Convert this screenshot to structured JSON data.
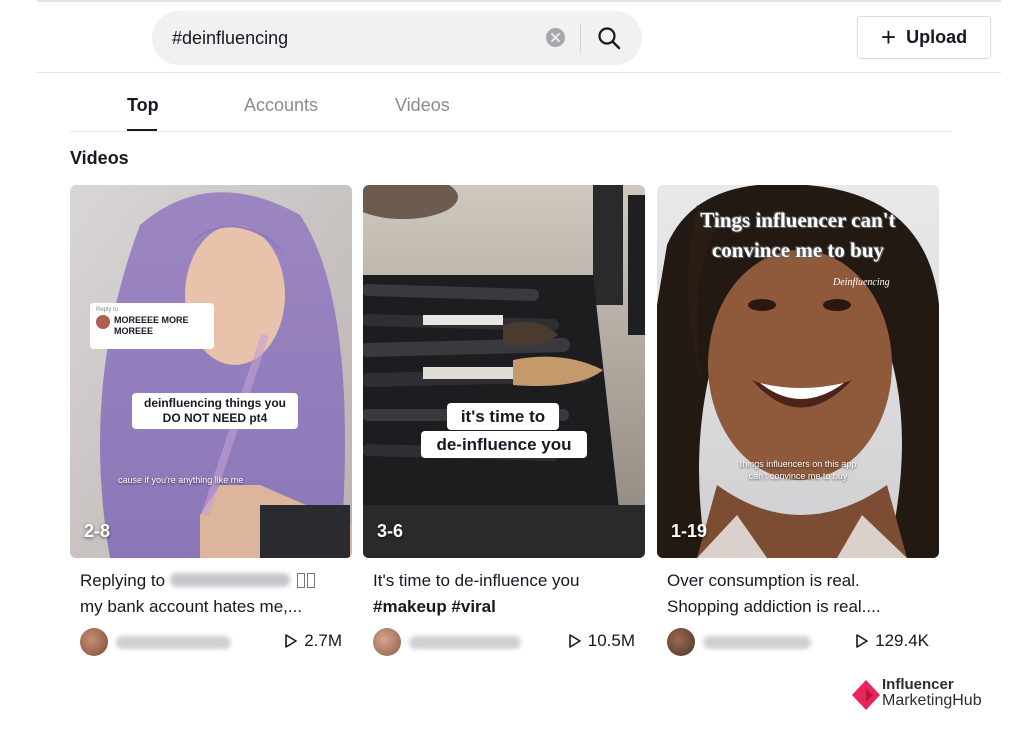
{
  "search": {
    "value": "#deinfluencing",
    "placeholder": "Search"
  },
  "header": {
    "upload_label": "Upload"
  },
  "tabs": [
    {
      "label": "Top",
      "active": true
    },
    {
      "label": "Accounts",
      "active": false
    },
    {
      "label": "Videos",
      "active": false
    }
  ],
  "section_title": "Videos",
  "videos": [
    {
      "duration": "2-8",
      "reply_bubble": "MOREEEE MORE MOREEE",
      "reply_to_label": "Reply to",
      "overlay_caption": "deinfluencing things you DO NOT NEED pt4",
      "small_overlay": "cause if you're anything like me",
      "desc_prefix": "Replying to",
      "desc_rest": "my bank account hates me,...",
      "views": "2.7M"
    },
    {
      "duration": "3-6",
      "overlay_line1": "it's time to",
      "overlay_line2": "de-influence you",
      "desc_line1": "It's time to de-influence you",
      "desc_tags": "#makeup #viral",
      "views": "10.5M"
    },
    {
      "duration": "1-19",
      "overlay_title": "Tings influencer can't convince me to buy",
      "overlay_tag": "Deinfluencing",
      "small_overlay": "things influencers on this app can't convince me to buy",
      "desc_line1": "Over consumption is real.",
      "desc_line2": "Shopping addiction is real....",
      "views": "129.4K"
    }
  ],
  "watermark": {
    "line1": "Influencer",
    "line2": "MarketingHub",
    "accent": "#e8245b"
  },
  "colors": {
    "text": "#161823",
    "muted": "#8a8b91",
    "search_bg": "#f1f1f2"
  }
}
